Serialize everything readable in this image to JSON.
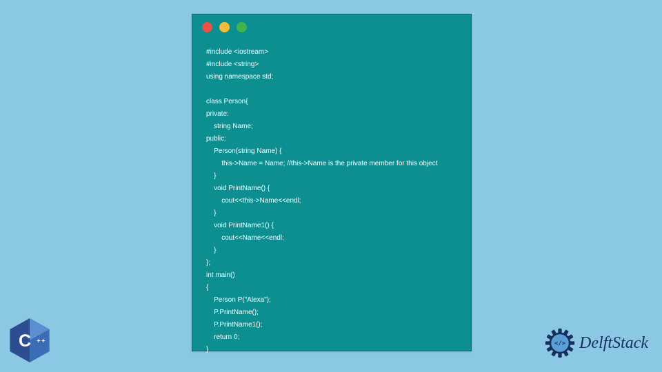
{
  "code": {
    "lines": [
      "#include <iostream>",
      "#include <string>",
      "using namespace std;",
      "",
      "class Person{",
      "private:",
      "    string Name;",
      "public:",
      "    Person(string Name) {",
      "        this->Name = Name; //this->Name is the private member for this object",
      "    }",
      "    void PrintName() {",
      "        cout<<this->Name<<endl;",
      "    }",
      "    void PrintName1() {",
      "        cout<<Name<<endl;",
      "    }",
      "};",
      "int main()",
      "{",
      "    Person P(\"Alexa\");",
      "    P.PrintName();",
      "    P.PrintName1();",
      "    return 0;",
      "}"
    ]
  },
  "cpp_badge": {
    "label": "C++"
  },
  "brand": {
    "name": "DelftStack"
  },
  "window_dots": {
    "red": "#ed5046",
    "yellow": "#f6bd3b",
    "green": "#3fb44b"
  }
}
